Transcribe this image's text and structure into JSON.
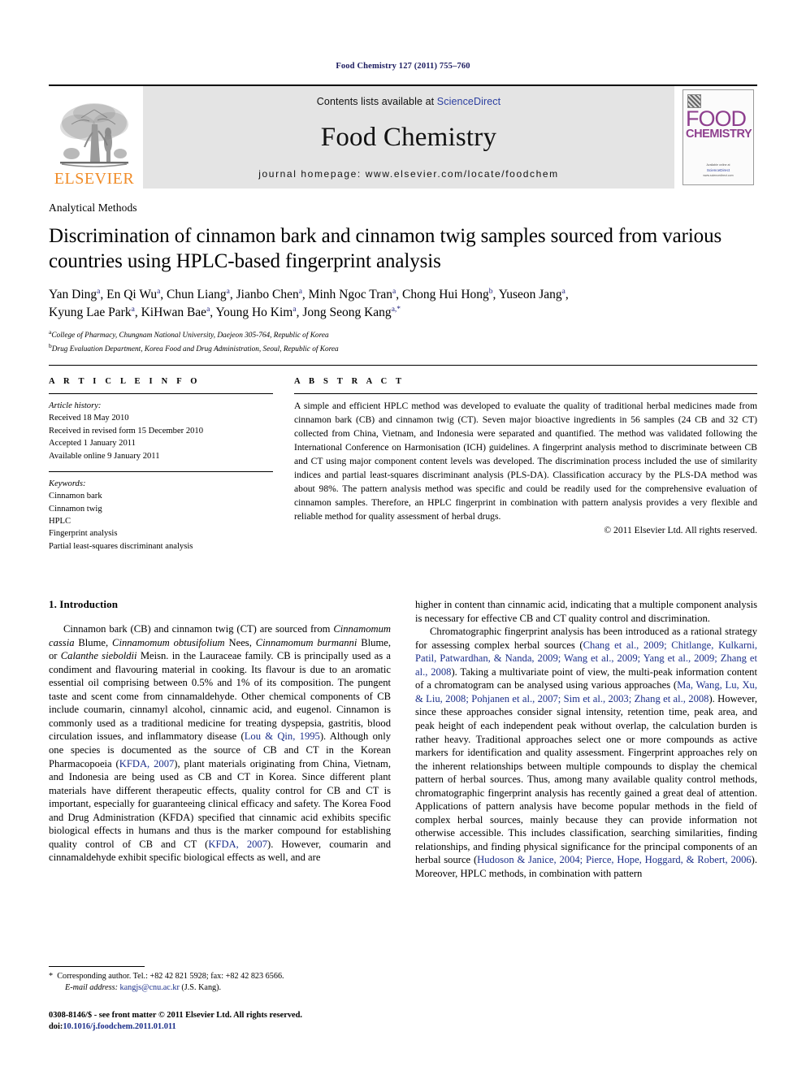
{
  "running_head": "Food Chemistry 127 (2011) 755–760",
  "masthead": {
    "publisher_name": "ELSEVIER",
    "contents_prefix": "Contents lists available at ",
    "contents_link": "ScienceDirect",
    "journal_title": "Food Chemistry",
    "homepage_line": "journal homepage: www.elsevier.com/locate/foodchem",
    "cover": {
      "line1": "FOOD",
      "line2": "CHEMISTRY",
      "footer_small": "Available online at",
      "footer_mark": "ScienceDirect",
      "footer_url": "www.sciencedirect.com"
    }
  },
  "article": {
    "section_label": "Analytical Methods",
    "title": "Discrimination of cinnamon bark and cinnamon twig samples sourced from various countries using HPLC-based fingerprint analysis",
    "authors_line1": "Yan Ding a, En Qi Wu a, Chun Liang a, Jianbo Chen a, Minh Ngoc Tran a, Chong Hui Hong b, Yuseon Jang a,",
    "authors_line2": "Kyung Lae Park a, KiHwan Bae a, Young Ho Kim a, Jong Seong Kang a,*",
    "authors": [
      {
        "name": "Yan Ding",
        "sup": "a"
      },
      {
        "name": "En Qi Wu",
        "sup": "a"
      },
      {
        "name": "Chun Liang",
        "sup": "a"
      },
      {
        "name": "Jianbo Chen",
        "sup": "a"
      },
      {
        "name": "Minh Ngoc Tran",
        "sup": "a"
      },
      {
        "name": "Chong Hui Hong",
        "sup": "b"
      },
      {
        "name": "Yuseon Jang",
        "sup": "a"
      },
      {
        "name": "Kyung Lae Park",
        "sup": "a"
      },
      {
        "name": "KiHwan Bae",
        "sup": "a"
      },
      {
        "name": "Young Ho Kim",
        "sup": "a"
      },
      {
        "name": "Jong Seong Kang",
        "sup": "a,*"
      }
    ],
    "affiliation_a_sup": "a",
    "affiliation_a": "College of Pharmacy, Chungnam National University, Daejeon 305-764, Republic of Korea",
    "affiliation_b_sup": "b",
    "affiliation_b": "Drug Evaluation Department, Korea Food and Drug Administration, Seoul, Republic of Korea"
  },
  "article_info": {
    "heading": "A R T I C L E   I N F O",
    "history_label": "Article history:",
    "history": [
      "Received 18 May 2010",
      "Received in revised form 15 December 2010",
      "Accepted 1 January 2011",
      "Available online 9 January 2011"
    ],
    "keywords_label": "Keywords:",
    "keywords": [
      "Cinnamon bark",
      "Cinnamon twig",
      "HPLC",
      "Fingerprint analysis",
      "Partial least-squares discriminant analysis"
    ]
  },
  "abstract": {
    "heading": "A B S T R A C T",
    "text": "A simple and efficient HPLC method was developed to evaluate the quality of traditional herbal medicines made from cinnamon bark (CB) and cinnamon twig (CT). Seven major bioactive ingredients in 56 samples (24 CB and 32 CT) collected from China, Vietnam, and Indonesia were separated and quantified. The method was validated following the International Conference on Harmonisation (ICH) guidelines. A fingerprint analysis method to discriminate between CB and CT using major component content levels was developed. The discrimination process included the use of similarity indices and partial least-squares discriminant analysis (PLS-DA). Classification accuracy by the PLS-DA method was about 98%. The pattern analysis method was specific and could be readily used for the comprehensive evaluation of cinnamon samples. Therefore, an HPLC fingerprint in combination with pattern analysis provides a very flexible and reliable method for quality assessment of herbal drugs.",
    "copyright": "© 2011 Elsevier Ltd. All rights reserved."
  },
  "body": {
    "section_heading": "1. Introduction",
    "left_para_1_a": "Cinnamon bark (CB) and cinnamon twig (CT) are sourced from ",
    "left_para_1_i1": "Cinnamomum cassia",
    "left_para_1_b1": " Blume, ",
    "left_para_1_i2": "Cinnamomum obtusifolium",
    "left_para_1_b2": " Nees, ",
    "left_para_1_i3": "Cinnamomum burmanni",
    "left_para_1_b3": " Blume, or ",
    "left_para_1_i4": "Calanthe sieboldii",
    "left_para_1_b4": " Meisn. in the Lauraceae family. CB is principally used as a condiment and flavouring material in cooking. Its flavour is due to an aromatic essential oil comprising between 0.5% and 1% of its composition. The pungent taste and scent come from cinnamaldehyde. Other chemical components of CB include coumarin, cinnamyl alcohol, cinnamic acid, and eugenol. Cinnamon is commonly used as a traditional medicine for treating dyspepsia, gastritis, blood circulation issues, and inflammatory disease (",
    "left_ref_1": "Lou & Qin, 1995",
    "left_para_1_b5": "). Although only one species is documented as the source of CB and CT in the Korean Pharmacopoeia (",
    "left_ref_2": "KFDA, 2007",
    "left_para_1_b6": "), plant materials originating from China, Vietnam, and Indonesia are being used as CB and CT in Korea. Since different plant materials have different therapeutic effects, quality control for CB and CT is important, especially for guaranteeing clinical efficacy and safety. The Korea Food and Drug Administration (KFDA) specified that cinnamic acid exhibits specific biological effects in humans and thus is the marker compound for establishing quality control of CB and CT (",
    "left_ref_3": "KFDA, 2007",
    "left_para_1_b7": "). However, coumarin and cinnamaldehyde exhibit specific biological effects as well, and are",
    "right_para_1_cont": "higher in content than cinnamic acid, indicating that a multiple component analysis is necessary for effective CB and CT quality control and discrimination.",
    "right_para_2_a": "Chromatographic fingerprint analysis has been introduced as a rational strategy for assessing complex herbal sources (",
    "right_ref_1": "Chang et al., 2009; Chitlange, Kulkarni, Patil, Patwardhan, & Nanda, 2009; Wang et al., 2009; Yang et al., 2009; Zhang et al., 2008",
    "right_para_2_b": "). Taking a multivariate point of view, the multi-peak information content of a chromatogram can be analysed using various approaches (",
    "right_ref_2": "Ma, Wang, Lu, Xu, & Liu, 2008; Pohjanen et al., 2007; Sim et al., 2003; Zhang et al., 2008",
    "right_para_2_c": "). However, since these approaches consider signal intensity, retention time, peak area, and peak height of each independent peak without overlap, the calculation burden is rather heavy. Traditional approaches select one or more compounds as active markers for identification and quality assessment. Fingerprint approaches rely on the inherent relationships between multiple compounds to display the chemical pattern of herbal sources. Thus, among many available quality control methods, chromatographic fingerprint analysis has recently gained a great deal of attention. Applications of pattern analysis have become popular methods in the field of complex herbal sources, mainly because they can provide information not otherwise accessible. This includes classification, searching similarities, finding relationships, and finding physical significance for the principal components of an herbal source (",
    "right_ref_3": "Hudoson & Janice, 2004; Pierce, Hope, Hoggard, & Robert, 2006",
    "right_para_2_d": "). Moreover, HPLC methods, in combination with pattern"
  },
  "footnotes": {
    "corresponding_marker": "*",
    "corresponding_text": "Corresponding author. Tel.: +82 42 821 5928; fax: +82 42 823 6566.",
    "email_label": "E-mail address:",
    "email": "kangjs@cnu.ac.kr",
    "email_owner": "(J.S. Kang).",
    "issn_line": "0308-8146/$ - see front matter © 2011 Elsevier Ltd. All rights reserved.",
    "doi_label": "doi:",
    "doi": "10.1016/j.foodchem.2011.01.011"
  },
  "colors": {
    "link": "#1c2f8a",
    "elsevier_orange": "#F08C28",
    "science_direct": "#2b3fa0",
    "cover_purple": "#8e3f8e",
    "banner_grey": "#e4e4e4"
  }
}
